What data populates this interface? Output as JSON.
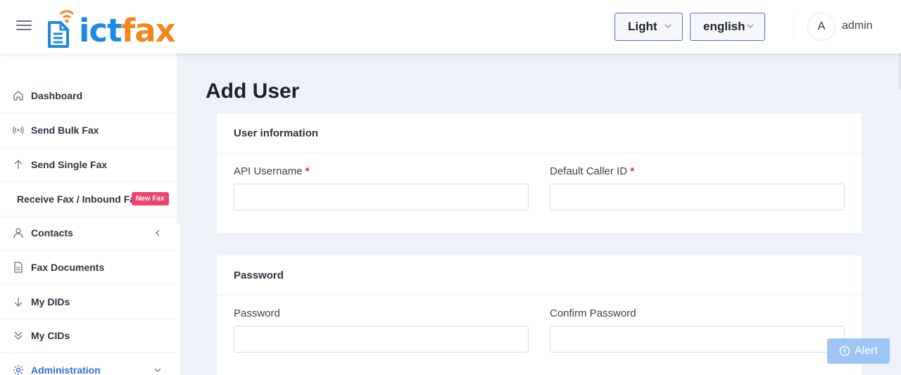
{
  "header": {
    "logo_ict": "ict",
    "logo_fax": "fax",
    "theme_select": "Light",
    "language_select": "english",
    "avatar_initial": "A",
    "username": "admin"
  },
  "sidebar": {
    "items": [
      {
        "label": "Dashboard",
        "icon": "home-icon"
      },
      {
        "label": "Send Bulk Fax",
        "icon": "broadcast-icon"
      },
      {
        "label": "Send Single Fax",
        "icon": "arrow-up-icon"
      },
      {
        "label": "Receive Fax / Inbound Fax",
        "badge": "New Fax"
      },
      {
        "label": "Contacts",
        "icon": "user-icon"
      },
      {
        "label": "Fax Documents",
        "icon": "document-icon"
      },
      {
        "label": "My DIDs",
        "icon": "arrow-down-icon"
      },
      {
        "label": "My CIDs",
        "icon": "double-chevron-down-icon"
      },
      {
        "label": "Administration",
        "icon": "gear-icon",
        "active": true
      }
    ]
  },
  "main": {
    "title": "Add User",
    "user_info": {
      "heading": "User information",
      "api_username_label": "API Username",
      "caller_id_label": "Default Caller ID",
      "required_mark": "*"
    },
    "password": {
      "heading": "Password",
      "password_label": "Password",
      "confirm_label": "Confirm Password"
    }
  },
  "alert_button": "Alert",
  "colors": {
    "accent": "#2f6fde",
    "logo_blue": "#1e88e5",
    "logo_orange": "#f5861f",
    "badge": "#f0436b",
    "required": "#e0202b"
  }
}
